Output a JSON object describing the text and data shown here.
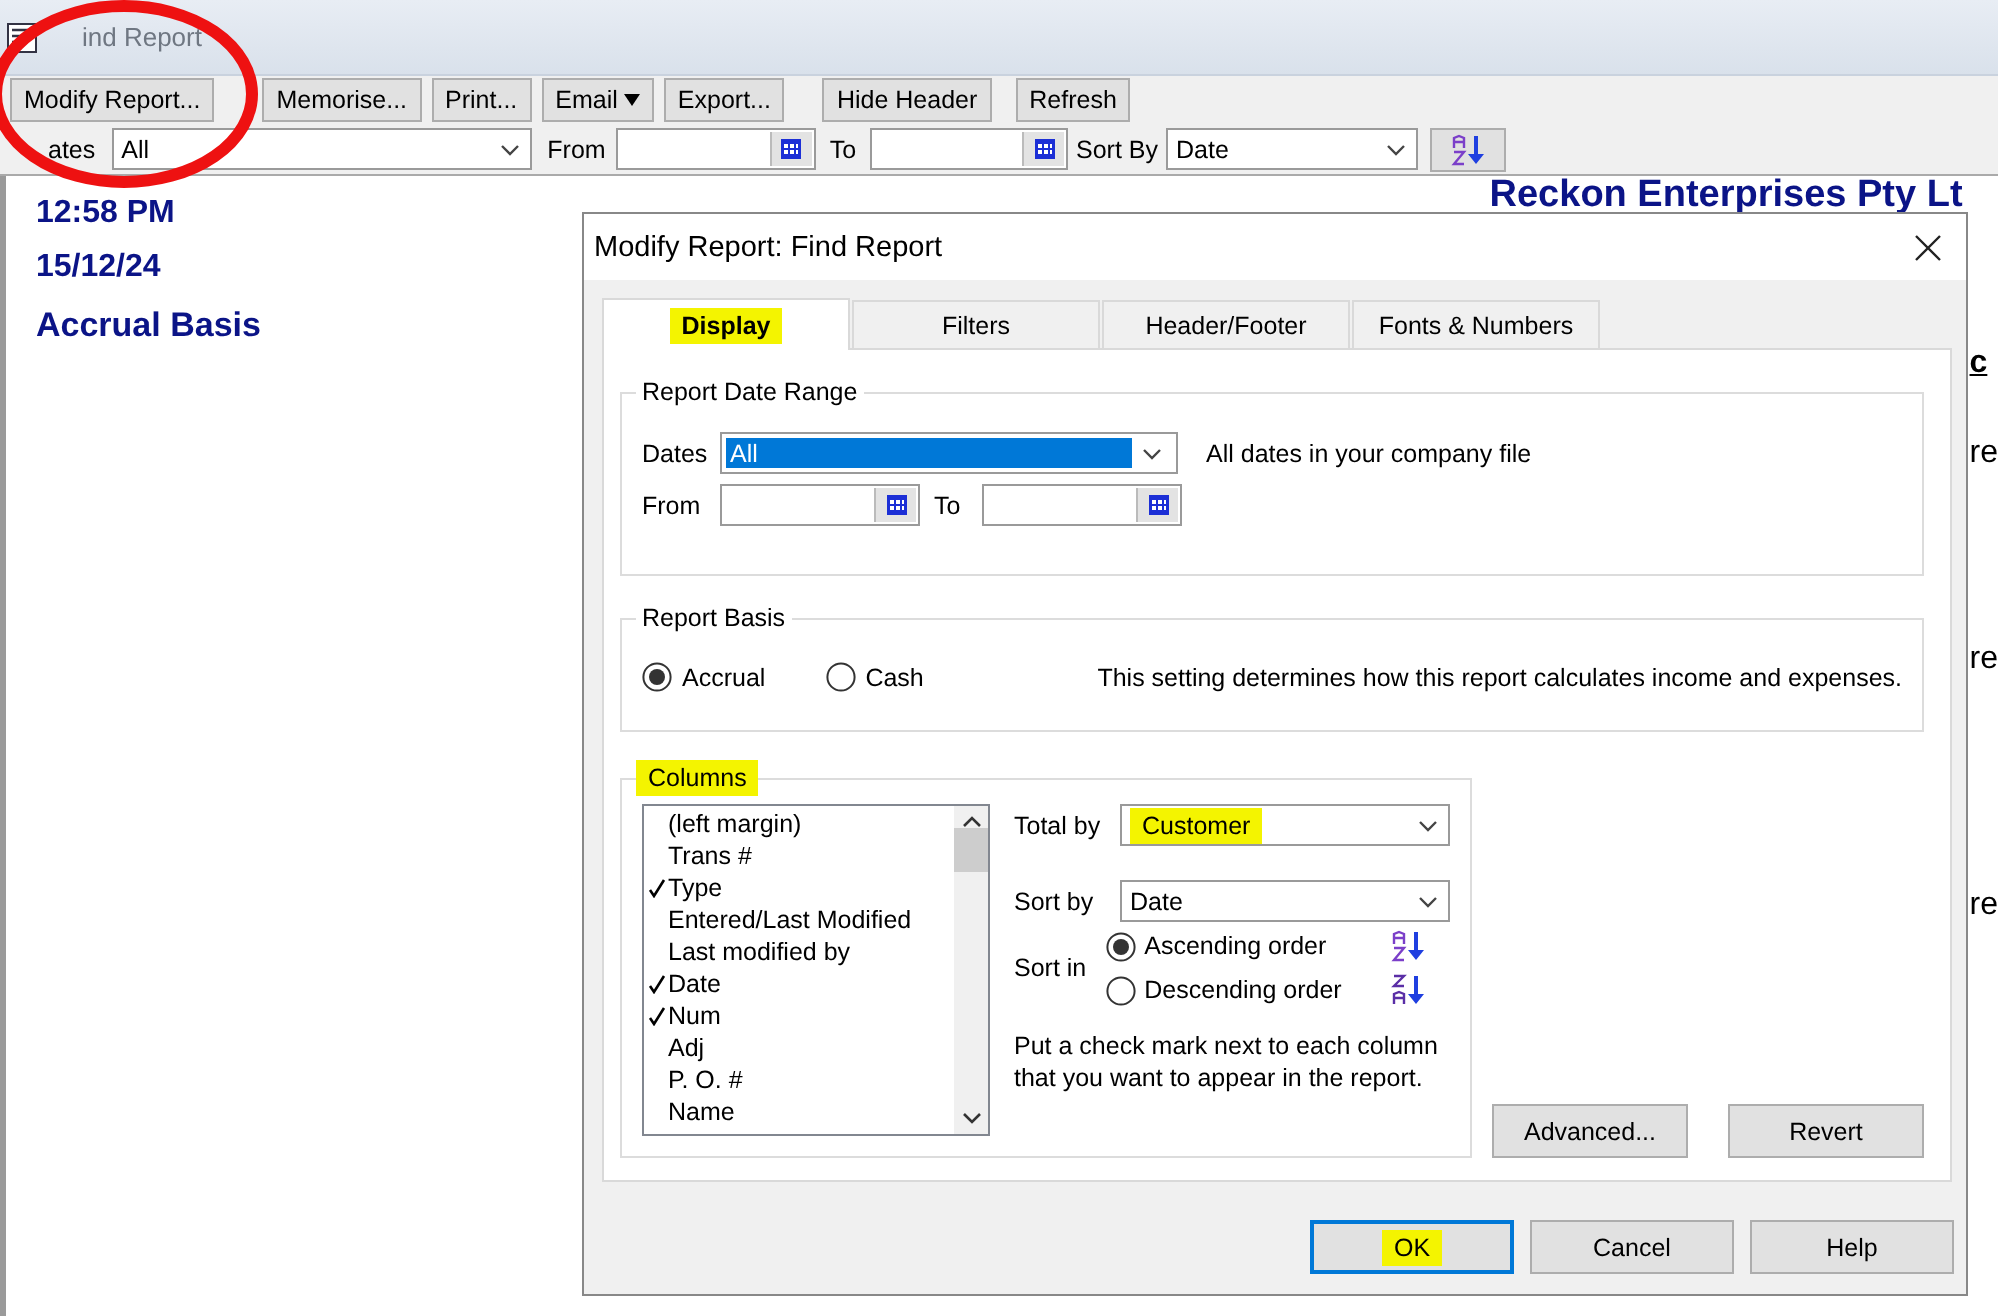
{
  "window": {
    "title": "ind Report"
  },
  "toolbar": {
    "buttons": [
      {
        "label": "Modify Report...",
        "kind": "button"
      },
      {
        "label": "Memorise...",
        "kind": "button"
      },
      {
        "label": "Print...",
        "kind": "button"
      },
      {
        "label": "Email",
        "kind": "menu"
      },
      {
        "label": "Export...",
        "kind": "button"
      },
      {
        "label": "Hide Header",
        "kind": "button"
      },
      {
        "label": "Refresh",
        "kind": "button"
      }
    ]
  },
  "filter_bar": {
    "dates_label": "ates",
    "dates_value": "All",
    "from_label": "From",
    "to_label": "To",
    "sort_by_label": "Sort By",
    "sort_by_value": "Date"
  },
  "report": {
    "time": "12:58 PM",
    "date": "15/12/24",
    "basis": "Accrual Basis",
    "company": "Reckon Enterprises Pty Lt",
    "column_fragments": [
      "c",
      "re",
      "re",
      "re"
    ]
  },
  "dialog": {
    "title": "Modify Report: Find Report",
    "tabs": [
      {
        "label": "Display",
        "selected": true,
        "highlighted": true
      },
      {
        "label": "Filters",
        "selected": false,
        "highlighted": false
      },
      {
        "label": "Header/Footer",
        "selected": false,
        "highlighted": false
      },
      {
        "label": "Fonts & Numbers",
        "selected": false,
        "highlighted": false
      }
    ],
    "date_range": {
      "legend": "Report Date Range",
      "dates_label": "Dates",
      "dates_value": "All",
      "from_label": "From",
      "to_label": "To",
      "note": "All dates in your company file"
    },
    "basis": {
      "legend": "Report Basis",
      "options": [
        {
          "label": "Accrual",
          "selected": true
        },
        {
          "label": "Cash",
          "selected": false
        }
      ],
      "note": "This setting determines how this report calculates income and expenses."
    },
    "columns": {
      "legend": "Columns",
      "legend_highlighted": true,
      "items": [
        {
          "label": "(left margin)",
          "checked": false
        },
        {
          "label": "Trans #",
          "checked": false
        },
        {
          "label": "Type",
          "checked": true
        },
        {
          "label": "Entered/Last Modified",
          "checked": false
        },
        {
          "label": "Last modified by",
          "checked": false
        },
        {
          "label": "Date",
          "checked": true
        },
        {
          "label": "Num",
          "checked": true
        },
        {
          "label": "Adj",
          "checked": false
        },
        {
          "label": "P. O. #",
          "checked": false
        },
        {
          "label": "Name",
          "checked": false
        }
      ],
      "total_by_label": "Total by",
      "total_by_value": "Customer",
      "total_by_highlighted": true,
      "sort_by_label": "Sort by",
      "sort_by_value": "Date",
      "sort_in_label": "Sort in",
      "sort_orders": [
        {
          "label": "Ascending order",
          "selected": true,
          "kind": "ascending"
        },
        {
          "label": "Descending order",
          "selected": false,
          "kind": "descending"
        }
      ],
      "hint": "Put a check mark next to each column that you want to appear in the report."
    },
    "side_buttons": [
      "Advanced...",
      "Revert"
    ],
    "buttons": [
      {
        "label": "OK",
        "default": true,
        "highlighted": true
      },
      {
        "label": "Cancel",
        "default": false,
        "highlighted": false
      },
      {
        "label": "Help",
        "default": false,
        "highlighted": false
      }
    ]
  },
  "annotations": [
    {
      "kind": "circle"
    }
  ]
}
